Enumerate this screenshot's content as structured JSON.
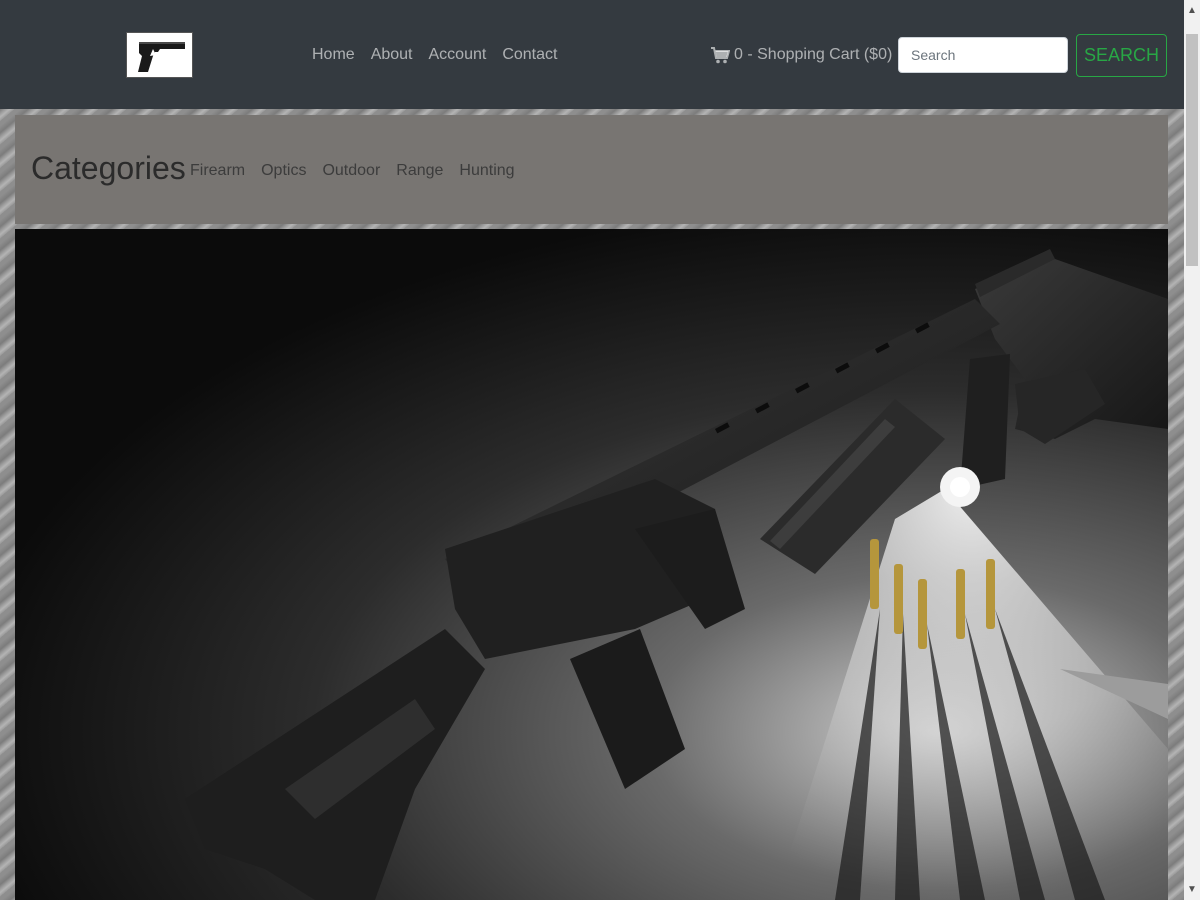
{
  "navbar": {
    "logo": {
      "icon": "pistol-logo-icon"
    },
    "links": [
      {
        "label": "Home"
      },
      {
        "label": "About"
      },
      {
        "label": "Account"
      },
      {
        "label": "Contact"
      }
    ],
    "cart": {
      "icon": "shopping-cart-icon",
      "label": "0 - Shopping Cart ($0)"
    },
    "search": {
      "placeholder": "Search",
      "value": "",
      "button_label": "SEARCH"
    }
  },
  "categories": {
    "heading": "Categories",
    "items": [
      {
        "label": "Firearm"
      },
      {
        "label": "Optics"
      },
      {
        "label": "Outdoor"
      },
      {
        "label": "Range"
      },
      {
        "label": "Hunting"
      }
    ]
  },
  "hero": {
    "image": "rifle-ammunition-flashlight-photo"
  },
  "colors": {
    "navbar_bg": "#343a40",
    "categories_bg": "#787572",
    "search_button": "#28a745"
  }
}
